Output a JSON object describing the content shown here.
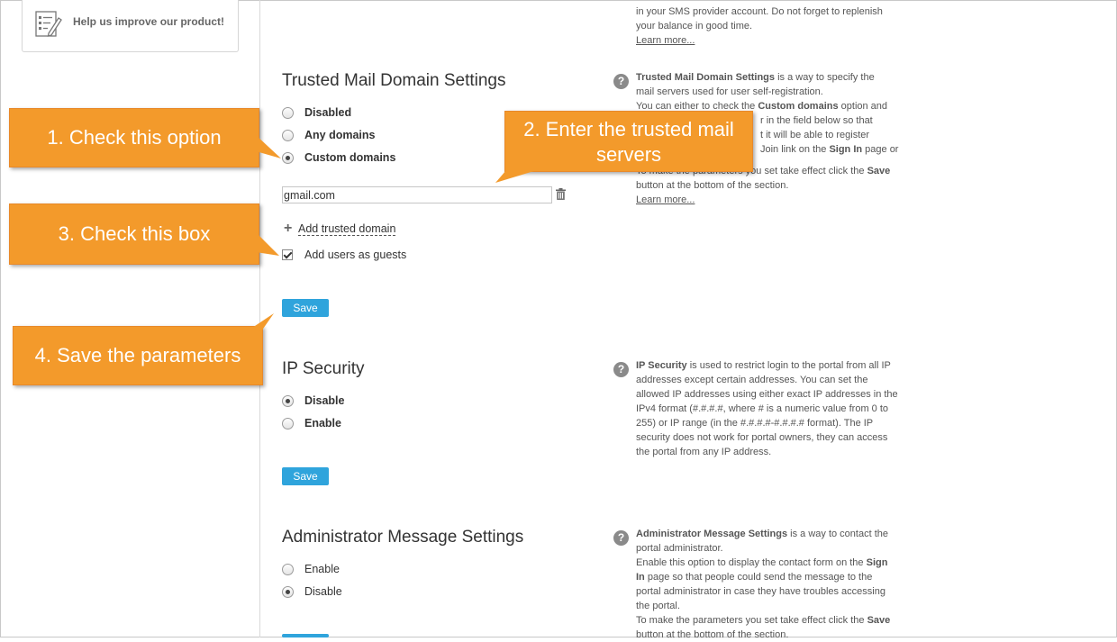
{
  "sidebar": {
    "feedback_label": "Help us improve our product!",
    "feedback_icon": "checklist-edit-icon"
  },
  "top_help": {
    "line1": "in your SMS provider account. Do not forget to replenish",
    "line2": "your balance in good time.",
    "learn_more": "Learn more..."
  },
  "trusted_domain": {
    "title": "Trusted Mail Domain Settings",
    "options": [
      {
        "label": "Disabled",
        "checked": false
      },
      {
        "label": "Any domains",
        "checked": false
      },
      {
        "label": "Custom domains",
        "checked": true
      }
    ],
    "domain_value": "gmail.com",
    "add_label": "Add trusted domain",
    "guests_label": "Add users as guests",
    "guests_checked": true,
    "save_label": "Save",
    "help": {
      "strong": "Trusted Mail Domain Settings",
      "l1_rest": " is a way to specify the",
      "l2": "mail servers used for user self-registration.",
      "l3_pre": "You can either to check the ",
      "l3_strong": "Custom domains",
      "l3_post": " option and",
      "l4": "r in the field below so that",
      "l5": "t it will be able to register",
      "l6_pre": "Join link on the ",
      "l6_strong": "Sign In",
      "l6_post": " page or",
      "l7_pre": "To make the parameters you set take effect click the ",
      "l7_strong": "Save",
      "l8": "button at the bottom of the section.",
      "learn_more": "Learn more..."
    }
  },
  "ip_security": {
    "title": "IP Security",
    "options": [
      {
        "label": "Disable",
        "checked": true
      },
      {
        "label": "Enable",
        "checked": false
      }
    ],
    "save_label": "Save",
    "help": {
      "strong": "IP Security",
      "l1_rest": " is used to restrict login to the portal from all IP",
      "l2": "addresses except certain addresses. You can set the",
      "l3": "allowed IP addresses using either exact IP addresses in the",
      "l4": "IPv4 format (#.#.#.#, where # is a numeric value from 0 to",
      "l5": "255) or IP range (in the #.#.#.#-#.#.#.# format). The IP",
      "l6": "security does not work for portal owners, they can access",
      "l7": "the portal from any IP address."
    }
  },
  "admin_message": {
    "title": "Administrator Message Settings",
    "options": [
      {
        "label": "Enable",
        "checked": false
      },
      {
        "label": "Disable",
        "checked": true
      }
    ],
    "help": {
      "strong": "Administrator Message Settings",
      "l1_rest": " is a way to contact the",
      "l2": "portal administrator.",
      "l3_pre": "Enable this option to display the contact form on the ",
      "l3_strong": "Sign",
      "l4_strong": "In",
      "l4_rest": " page so that people could send the message to the",
      "l5": "portal administrator in case they have troubles accessing",
      "l6": "the portal.",
      "l7_pre": "To make the parameters you set take effect click the ",
      "l7_strong": "Save",
      "l8": "button at the bottom of the section."
    }
  },
  "callouts": {
    "c1": "1. Check this option",
    "c2_l1": "2. Enter the trusted mail",
    "c2_l2": "servers",
    "c3": "3. Check this box",
    "c4": "4. Save the parameters"
  },
  "colors": {
    "callout": "#f39a2b",
    "save_button": "#2fa4dc"
  }
}
